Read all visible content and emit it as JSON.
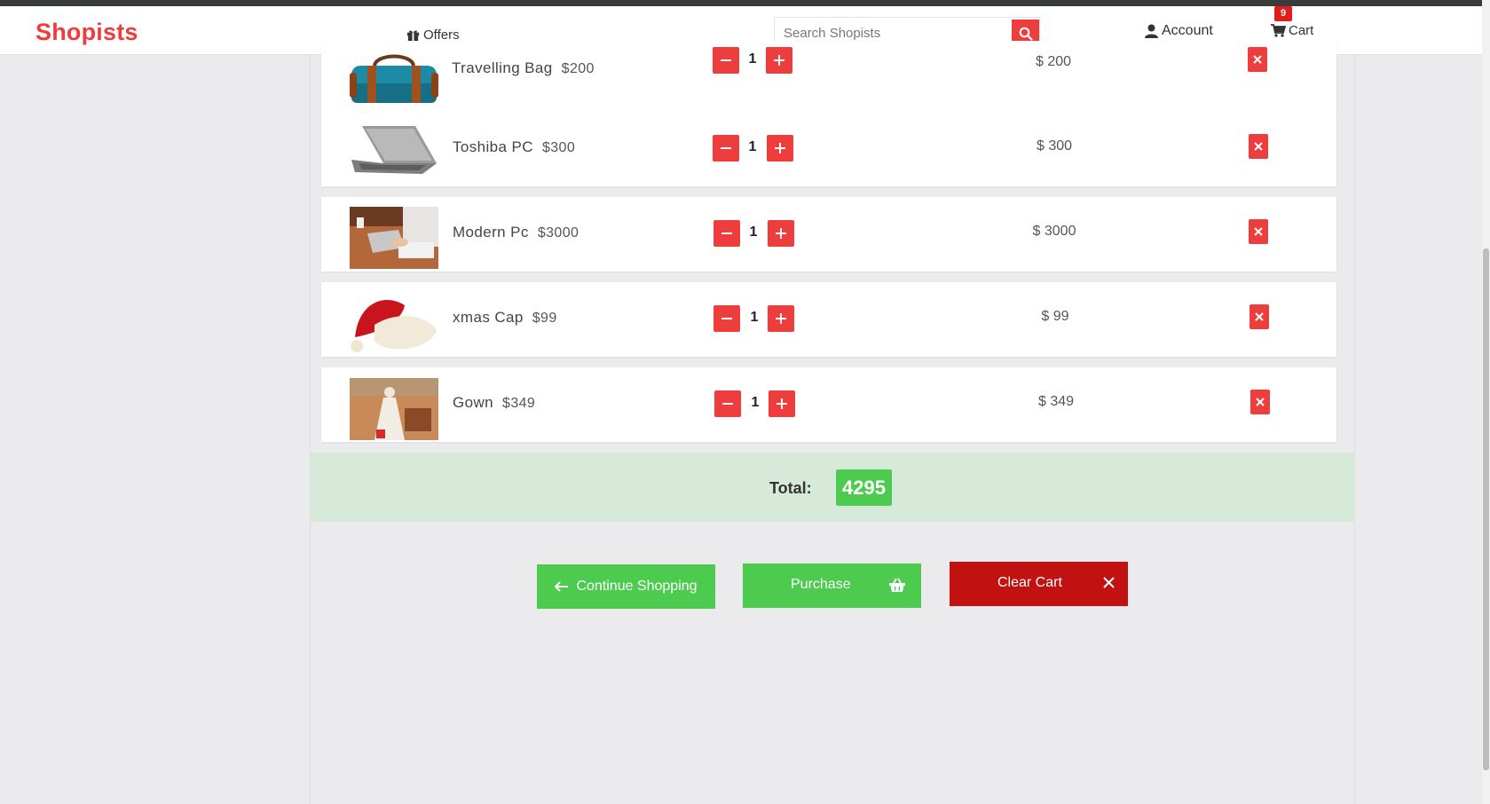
{
  "nav": {
    "brand": "Shopists",
    "offers_label": "Offers",
    "search_placeholder": "Search Shopists",
    "account_label": "Account",
    "cart_label": "Cart",
    "cart_count": "9",
    "brand_color": "#ee3d3d"
  },
  "cart": {
    "items": [
      {
        "name": "Travelling Bag",
        "price": "$200",
        "quantity": "1",
        "line_total": "$ 200",
        "image": "travel-bag-image"
      },
      {
        "name": "Toshiba PC",
        "price": "$300",
        "quantity": "1",
        "line_total": "$ 300",
        "image": "laptop-image"
      },
      {
        "name": "Modern Pc",
        "price": "$3000",
        "quantity": "1",
        "line_total": "$ 3000",
        "image": "person-typing-laptop-image"
      },
      {
        "name": "xmas Cap",
        "price": "$99",
        "quantity": "1",
        "line_total": "$ 99",
        "image": "santa-hat-image"
      },
      {
        "name": "Gown",
        "price": "$349",
        "quantity": "1",
        "line_total": "$ 349",
        "image": "white-gown-image"
      }
    ],
    "total_label": "Total:",
    "total_value": "4295"
  },
  "actions": {
    "continue_label": "Continue Shopping",
    "purchase_label": "Purchase",
    "clear_label": "Clear Cart"
  },
  "colors": {
    "accent_red": "#ee3d3d",
    "success_green": "#4ccb4f",
    "danger_dark_red": "#c11111",
    "total_bar_bg": "#d7e9d8"
  }
}
